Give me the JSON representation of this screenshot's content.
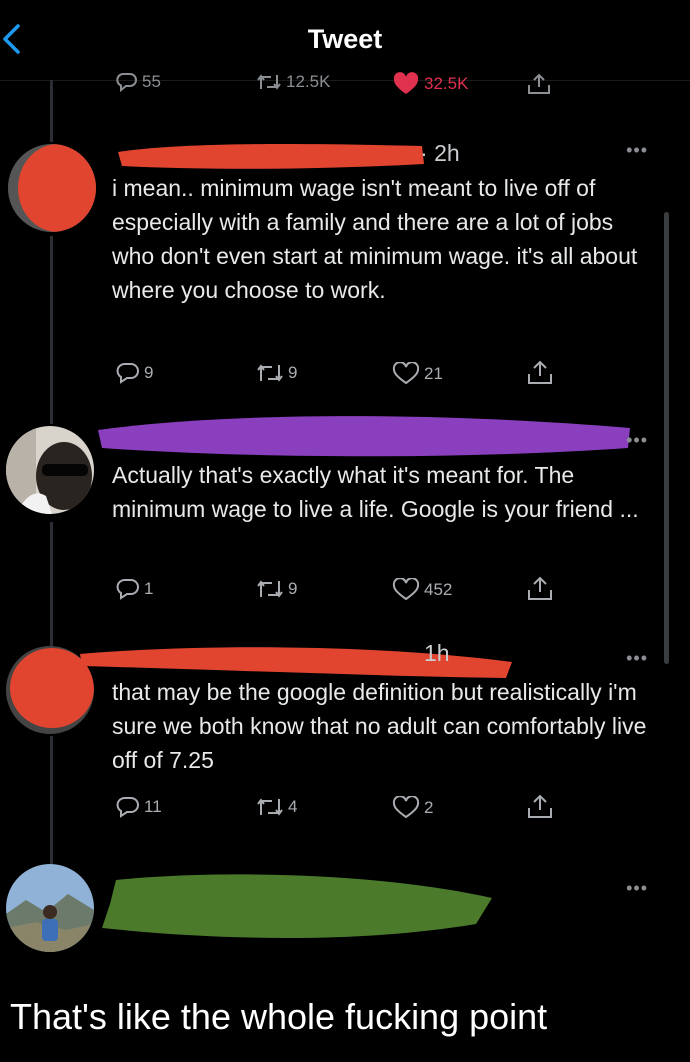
{
  "header": {
    "title": "Tweet"
  },
  "main_tweet_stats": {
    "replies": "55",
    "retweets": "12.5K",
    "likes": "32.5K"
  },
  "replies": [
    {
      "time": "2h",
      "text": "i mean.. minimum wage isn't meant to live off of especially with a family and there are a lot of jobs who don't even start at minimum wage. it's all about where you choose to work.",
      "reply_count": "9",
      "retweet_count": "9",
      "like_count": "21",
      "redaction_color": "#e2452f"
    },
    {
      "text": "Actually that's exactly what it's meant for. The minimum wage to live a life. Google is your friend ...",
      "reply_count": "1",
      "retweet_count": "9",
      "like_count": "452",
      "redaction_color": "#8a3fbf"
    },
    {
      "time": "1h",
      "text": "that may be the google definition but realistically i'm sure we both know that no adult can comfortably live off of 7.25",
      "reply_count": "11",
      "retweet_count": "4",
      "like_count": "2",
      "redaction_color": "#e2452f"
    },
    {
      "redaction_color": "#4b7a2a"
    }
  ],
  "caption": "That's like the whole fucking point",
  "icons": [
    "back-chevron-icon",
    "reply-icon",
    "retweet-icon",
    "heart-icon",
    "share-icon",
    "more-icon"
  ]
}
